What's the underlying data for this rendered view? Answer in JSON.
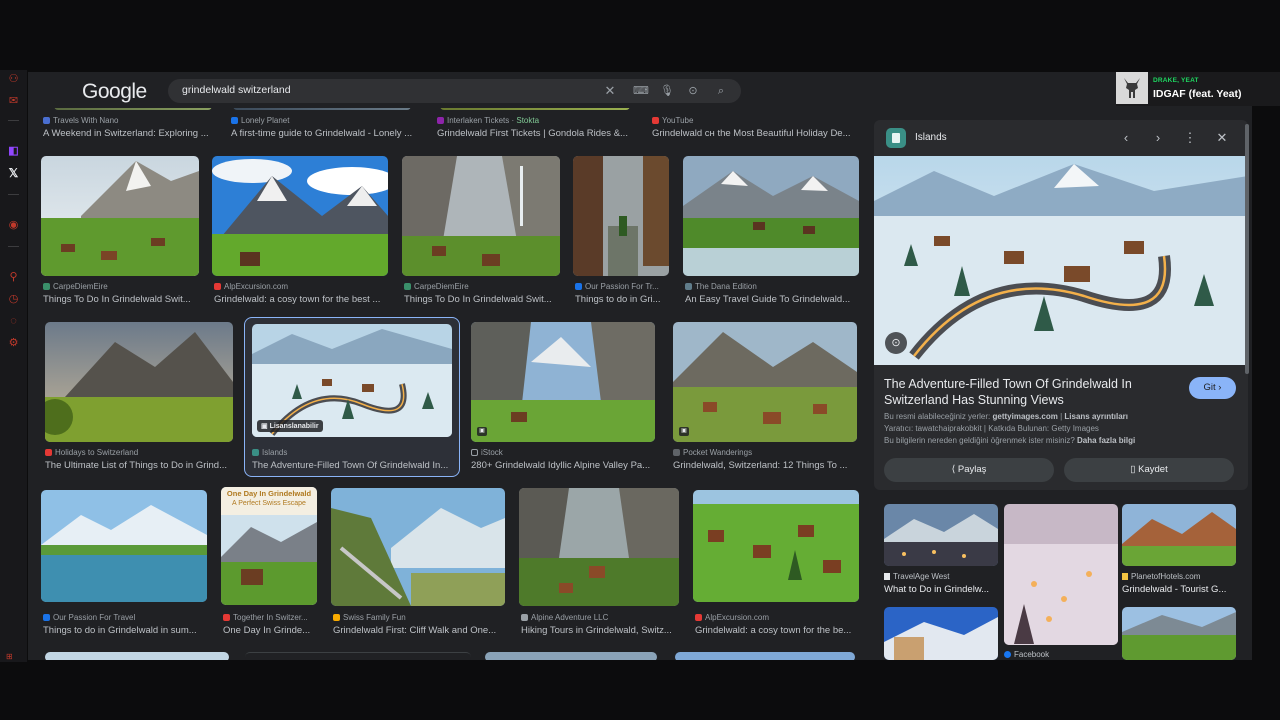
{
  "header": {
    "logo_text": "Google",
    "search_query": "grindelwald switzerland"
  },
  "player": {
    "artist": "DRAKE, YEAT",
    "title": "IDGAF (feat. Yeat)"
  },
  "top_row": [
    {
      "source": "Travels With Nano",
      "title": "A Weekend in Switzerland: Exploring ..."
    },
    {
      "source": "Lonely Planet",
      "title": "A first-time guide to Grindelwald - Lonely ..."
    },
    {
      "source": "Interlaken Tickets",
      "stock": "Stokta",
      "title": "Grindelwald First Tickets | Gondola Rides &..."
    },
    {
      "source": "YouTube",
      "title": "Grindelwald сн the Most Beautiful Holiday De..."
    }
  ],
  "row1": [
    {
      "source": "CarpeDiemEire",
      "title": "Things To Do In Grindelwald Swit..."
    },
    {
      "source": "AlpExcursion.com",
      "title": "Grindelwald: a cosy town for the best ..."
    },
    {
      "source": "CarpeDiemEire",
      "title": "Things To Do In Grindelwald Swit..."
    },
    {
      "source": "Our Passion For Tr...",
      "title": "Things to do in Gri..."
    },
    {
      "source": "The Dana Edition",
      "title": "An Easy Travel Guide To Grindelwald..."
    }
  ],
  "row2": [
    {
      "source": "Holidays to Switzerland",
      "title": "The Ultimate List of Things to Do in Grind..."
    },
    {
      "source": "Islands",
      "title": "The Adventure-Filled Town Of Grindelwald In...",
      "badge": "Lisanslanabilir"
    },
    {
      "source": "iStock",
      "title": "280+ Grindelwald Idyllic Alpine Valley Pa..."
    },
    {
      "source": "Pocket Wanderings",
      "title": "Grindelwald, Switzerland: 12 Things To ..."
    }
  ],
  "row3": [
    {
      "source": "Our Passion For Travel",
      "title": "Things to do in Grindelwald in sum..."
    },
    {
      "source": "Together In Switzer...",
      "title": "One Day In Grinde...",
      "overlay_title": "One Day In Grindelwald",
      "overlay_sub": "A Perfect Swiss Escape"
    },
    {
      "source": "Swiss Family Fun",
      "title": "Grindelwald First: Cliff Walk and One..."
    },
    {
      "source": "Alpine Adventure LLC",
      "title": "Hiking Tours in Grindelwald, Switz..."
    },
    {
      "source": "AlpExcursion.com",
      "title": "Grindelwald: a cosy town for the be..."
    }
  ],
  "panel": {
    "source": "Islands",
    "title": "The Adventure-Filled Town Of Grindelwald In Switzerland Has Stunning Views",
    "visit_label": "Git",
    "avail_prefix": "Bu resmi alabileceğiniz yerler: ",
    "avail_site": "gettyimages.com",
    "avail_sep": " | ",
    "avail_license": "Lisans ayrıntıları",
    "creator_line": "Yaratıcı: tawatchaiprakobkit | Katkıda Bulunan: Getty Images",
    "learn_prefix": "Bu bilgilerin nereden geldiğini öğrenmek ister misiniz? ",
    "learn_more": "Daha fazla bilgi",
    "share_label": "Paylaş",
    "save_label": "Kaydet"
  },
  "related": [
    {
      "source": "TravelAge West",
      "title": "What to Do in Grindelw..."
    },
    {
      "source": "Facebook",
      "title": ""
    },
    {
      "source": "PlanetofHotels.com",
      "title": "Grindelwald - Tourist G..."
    }
  ],
  "colors": {
    "accent": "#8ab4f8",
    "background": "#202124",
    "spotify_green": "#1ed760"
  }
}
